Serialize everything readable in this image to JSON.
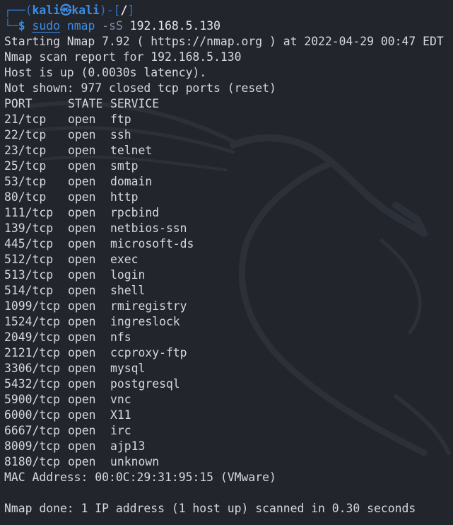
{
  "prompt": {
    "corner_top": "┌──(",
    "user": "kali",
    "at_symbol": "㉿",
    "host": "kali",
    "close_paren": ")-[",
    "path": "/",
    "close_bracket": "]",
    "corner_bottom": "└─",
    "dollar": "$"
  },
  "command": {
    "sudo": "sudo",
    "program": "nmap",
    "flag": "-sS",
    "target": "192.168.5.130"
  },
  "output": {
    "starting": "Starting Nmap 7.92 ( https://nmap.org ) at 2022-04-29 00:47 EDT",
    "report": "Nmap scan report for 192.168.5.130",
    "host_up": "Host is up (0.0030s latency).",
    "not_shown": "Not shown: 977 closed tcp ports (reset)",
    "headers": {
      "port": "PORT",
      "state": "STATE",
      "service": "SERVICE"
    },
    "ports": [
      {
        "port": "21/tcp",
        "state": "open",
        "service": "ftp"
      },
      {
        "port": "22/tcp",
        "state": "open",
        "service": "ssh"
      },
      {
        "port": "23/tcp",
        "state": "open",
        "service": "telnet"
      },
      {
        "port": "25/tcp",
        "state": "open",
        "service": "smtp"
      },
      {
        "port": "53/tcp",
        "state": "open",
        "service": "domain"
      },
      {
        "port": "80/tcp",
        "state": "open",
        "service": "http"
      },
      {
        "port": "111/tcp",
        "state": "open",
        "service": "rpcbind"
      },
      {
        "port": "139/tcp",
        "state": "open",
        "service": "netbios-ssn"
      },
      {
        "port": "445/tcp",
        "state": "open",
        "service": "microsoft-ds"
      },
      {
        "port": "512/tcp",
        "state": "open",
        "service": "exec"
      },
      {
        "port": "513/tcp",
        "state": "open",
        "service": "login"
      },
      {
        "port": "514/tcp",
        "state": "open",
        "service": "shell"
      },
      {
        "port": "1099/tcp",
        "state": "open",
        "service": "rmiregistry"
      },
      {
        "port": "1524/tcp",
        "state": "open",
        "service": "ingreslock"
      },
      {
        "port": "2049/tcp",
        "state": "open",
        "service": "nfs"
      },
      {
        "port": "2121/tcp",
        "state": "open",
        "service": "ccproxy-ftp"
      },
      {
        "port": "3306/tcp",
        "state": "open",
        "service": "mysql"
      },
      {
        "port": "5432/tcp",
        "state": "open",
        "service": "postgresql"
      },
      {
        "port": "5900/tcp",
        "state": "open",
        "service": "vnc"
      },
      {
        "port": "6000/tcp",
        "state": "open",
        "service": "X11"
      },
      {
        "port": "6667/tcp",
        "state": "open",
        "service": "irc"
      },
      {
        "port": "8009/tcp",
        "state": "open",
        "service": "ajp13"
      },
      {
        "port": "8180/tcp",
        "state": "open",
        "service": "unknown"
      }
    ],
    "mac": "MAC Address: 00:0C:29:31:95:15 (VMware)",
    "done": "Nmap done: 1 IP address (1 host up) scanned in 0.30 seconds"
  },
  "colors": {
    "background": "#22252c",
    "prompt_blue": "#3b8ee8",
    "text": "#d6d8de"
  },
  "icons": {
    "watermark": "kali-dragon-icon"
  }
}
